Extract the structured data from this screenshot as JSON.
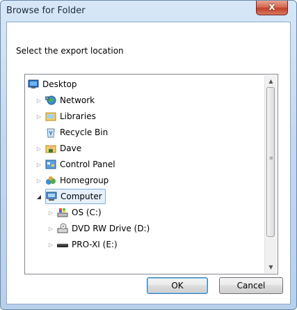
{
  "window": {
    "title": "Browse for Folder",
    "close_label": "x"
  },
  "instruction": "Select the export location",
  "tree": {
    "items": [
      {
        "label": "Desktop",
        "icon": "desktop-icon",
        "expander": ""
      },
      {
        "label": "Network",
        "icon": "network-icon",
        "expander": "▷"
      },
      {
        "label": "Libraries",
        "icon": "libraries-icon",
        "expander": "▷"
      },
      {
        "label": "Recycle Bin",
        "icon": "recycle-bin-icon",
        "expander": ""
      },
      {
        "label": "Dave",
        "icon": "user-folder-icon",
        "expander": "▷"
      },
      {
        "label": "Control Panel",
        "icon": "control-panel-icon",
        "expander": "▷"
      },
      {
        "label": "Homegroup",
        "icon": "homegroup-icon",
        "expander": "▷"
      },
      {
        "label": "Computer",
        "icon": "computer-icon",
        "expander": "◢"
      },
      {
        "label": "OS (C:)",
        "icon": "hard-drive-icon",
        "expander": "▷"
      },
      {
        "label": "DVD RW Drive (D:)",
        "icon": "dvd-drive-icon",
        "expander": "▷"
      },
      {
        "label": "PRO-XI (E:)",
        "icon": "usb-drive-icon",
        "expander": "▷"
      }
    ]
  },
  "scrollbar": {
    "up": "▲",
    "down": "▼",
    "grip": "≡"
  },
  "buttons": {
    "ok": "OK",
    "cancel": "Cancel"
  },
  "colors": {
    "selection": "#e5f0fb",
    "selection_border": "#84acdd"
  }
}
